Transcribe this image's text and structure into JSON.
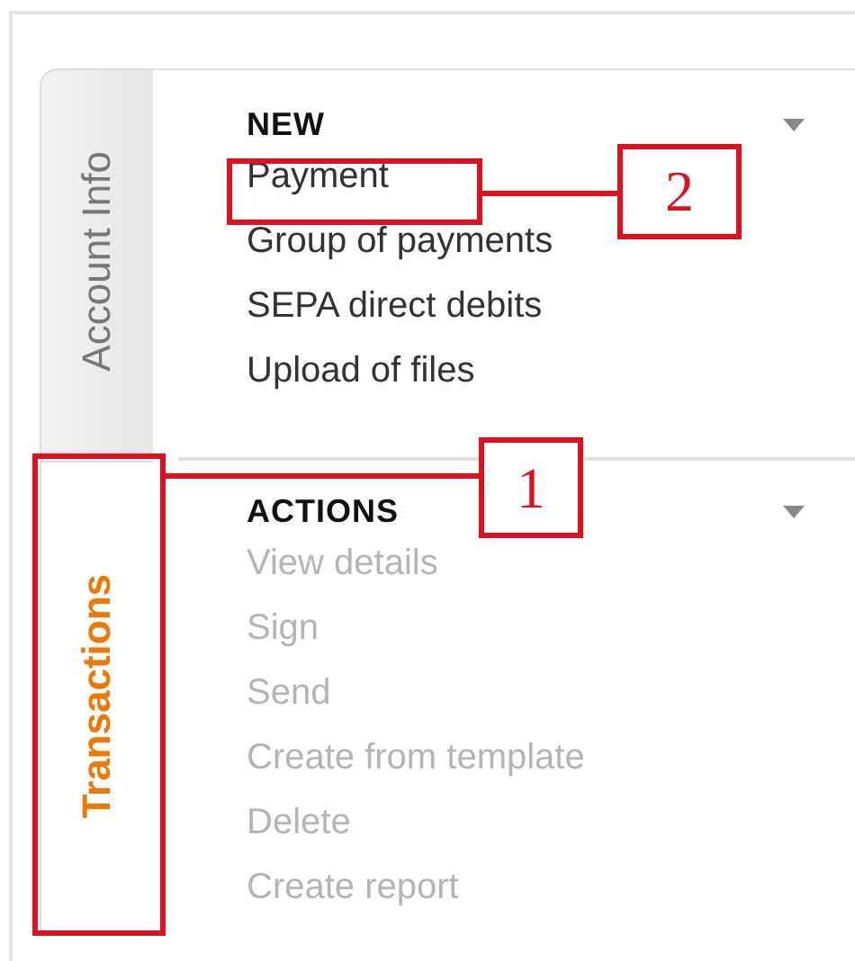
{
  "tabs": [
    {
      "label": "Account Info",
      "selected": false
    },
    {
      "label": "Transactions",
      "selected": true
    }
  ],
  "sections": [
    {
      "title": "NEW",
      "items": [
        {
          "label": "Payment",
          "disabled": false
        },
        {
          "label": "Group of payments",
          "disabled": false
        },
        {
          "label": "SEPA direct debits",
          "disabled": false
        },
        {
          "label": "Upload of files",
          "disabled": false
        }
      ]
    },
    {
      "title": "ACTIONS",
      "items": [
        {
          "label": "View details",
          "disabled": true
        },
        {
          "label": "Sign",
          "disabled": true
        },
        {
          "label": "Send",
          "disabled": true
        },
        {
          "label": "Create from template",
          "disabled": true
        },
        {
          "label": "Delete",
          "disabled": true
        },
        {
          "label": "Create report",
          "disabled": true
        }
      ]
    }
  ],
  "callouts": [
    {
      "number": "2"
    },
    {
      "number": "1"
    }
  ]
}
